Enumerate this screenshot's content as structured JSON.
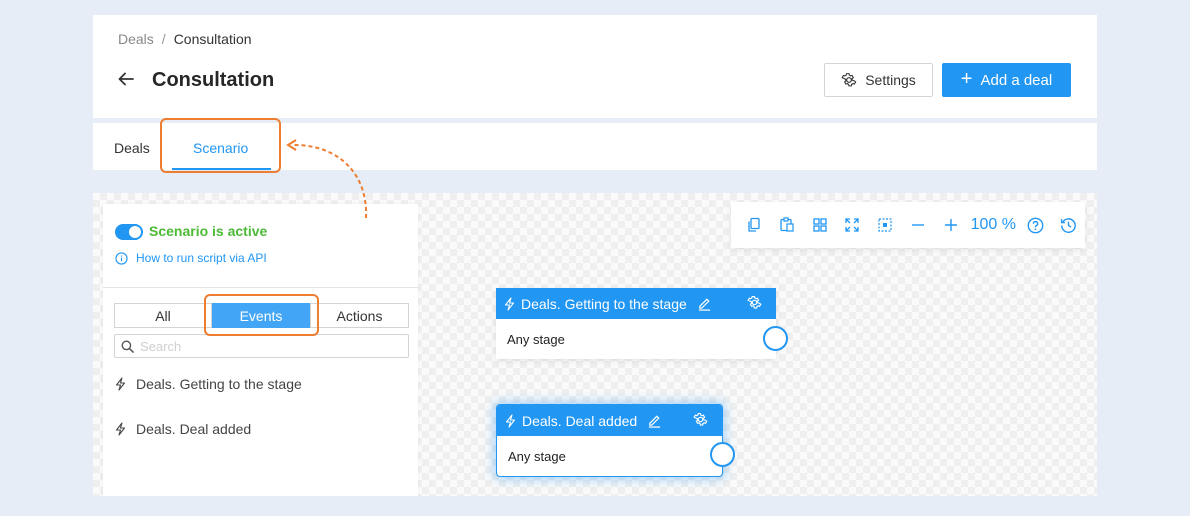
{
  "breadcrumb": {
    "parent": "Deals",
    "separator": "/",
    "current": "Consultation"
  },
  "header": {
    "title": "Consultation",
    "settings_label": "Settings",
    "add_label": "Add a deal"
  },
  "tabs": [
    {
      "label": "Deals",
      "active": false
    },
    {
      "label": "Scenario",
      "active": true
    }
  ],
  "panel": {
    "status": "Scenario is active",
    "toggle_on": true,
    "api_link": "How to run script via API",
    "filters": [
      "All",
      "Events",
      "Actions"
    ],
    "selected_filter": "Events",
    "search_placeholder": "Search",
    "events": [
      {
        "label": "Deals. Getting to the stage",
        "icon": "lightning-icon"
      },
      {
        "label": "Deals. Deal added",
        "icon": "lightning-icon"
      }
    ]
  },
  "toolbar": {
    "tools": [
      "copy-icon",
      "paste-icon",
      "grid-icon",
      "fit-screen-icon",
      "select-area-icon",
      "zoom-out-icon",
      "zoom-in-icon"
    ],
    "zoom": "100 %",
    "extra_tools": [
      "help-icon",
      "history-icon"
    ]
  },
  "nodes": [
    {
      "title": "Deals. Getting to the stage",
      "body": "Any stage",
      "selected": false
    },
    {
      "title": "Deals. Deal added",
      "body": "Any stage",
      "selected": true
    }
  ],
  "colors": {
    "accent": "#2196f3",
    "active_green": "#4cba37",
    "highlight_orange": "#ed7d31"
  }
}
